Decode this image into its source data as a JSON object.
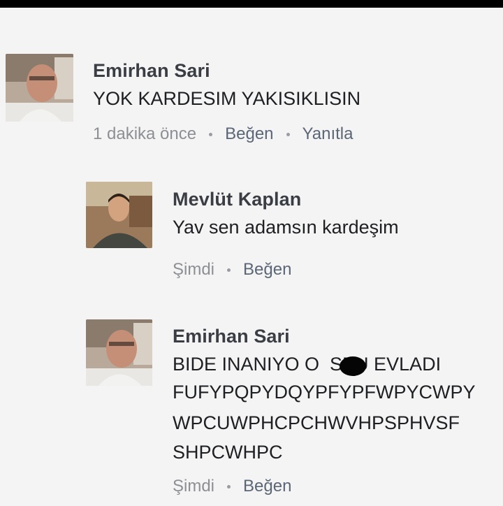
{
  "comments": [
    {
      "author": "Emirhan Sari",
      "text": "YOK KARDESIM YAKISIKLISIN",
      "time": "1 dakika önce",
      "like_label": "Beğen",
      "reply_label": "Yanıtla"
    },
    {
      "author": "Mevlüt Kaplan",
      "text": "Yav sen adamsın kardeşim",
      "time": "Şimdi",
      "like_label": "Beğen"
    },
    {
      "author": "Emirhan Sari",
      "text_lines": [
        "BIDE INANIYO O  SPU EVLADI",
        "FUFYPQPYDQYPFYPFWPYCWPY",
        "WPCUWPHCPCHWVHPSPHVSF",
        "SHPCWHPC"
      ],
      "time": "Şimdi",
      "like_label": "Beğen"
    }
  ]
}
